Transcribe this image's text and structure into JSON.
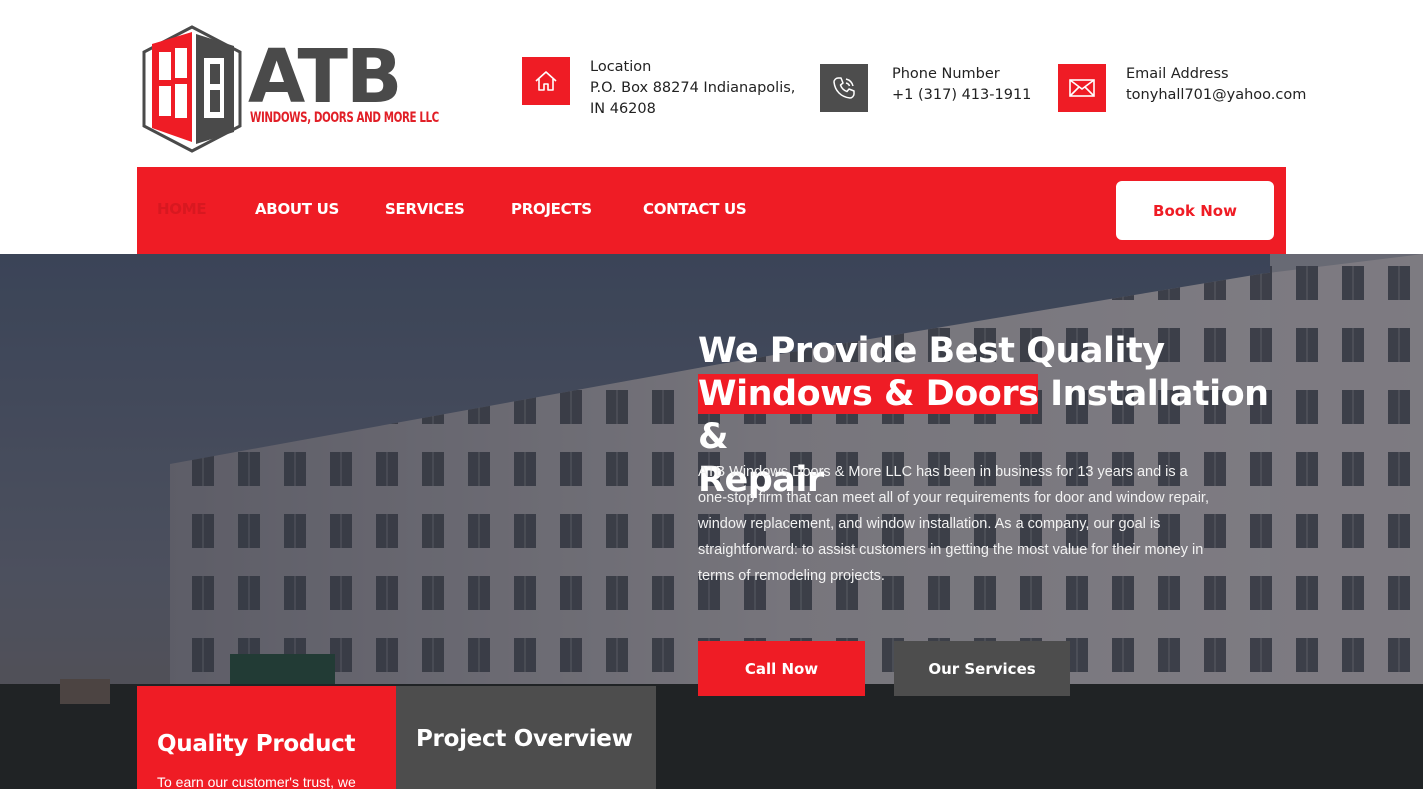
{
  "brand": {
    "name": "ATB",
    "tagline": "WINDOWS, DOORS AND MORE LLC",
    "accent": "#ef1c25",
    "dark": "#4d4d4d"
  },
  "contact": {
    "location": {
      "icon": "home-icon",
      "title": "Location",
      "value": "P.O. Box 88274 Indianapolis, IN 46208"
    },
    "phone": {
      "icon": "phone-icon",
      "title": "Phone Number",
      "value": "+1 (317) 413-1911"
    },
    "email": {
      "icon": "mail-icon",
      "title": "Email Address",
      "value": "tonyhall701@yahoo.com"
    }
  },
  "nav": {
    "items": [
      {
        "label": "HOME",
        "active": true
      },
      {
        "label": "ABOUT US"
      },
      {
        "label": "SERVICES"
      },
      {
        "label": "PROJECTS"
      },
      {
        "label": "CONTACT US"
      }
    ],
    "cta": "Book Now"
  },
  "hero": {
    "title_line1": "We Provide Best Quality",
    "title_highlight": "Windows & Doors",
    "title_rest1": " Installation &",
    "title_line3": "Repair",
    "description": "ATB Windows Doors & More LLC has been in business for 13 years and is a one-stop firm that can meet all of your requirements for door and window repair, window replacement, and window installation. As a company, our goal is straightforward: to assist customers in getting the most value for their money in terms of remodeling projects.",
    "primary_button": "Call Now",
    "secondary_button": "Our Services"
  },
  "cards": [
    {
      "title": "Quality Product",
      "text": "To earn our customer's trust, we"
    },
    {
      "title": "Project Overview",
      "text": ""
    }
  ]
}
